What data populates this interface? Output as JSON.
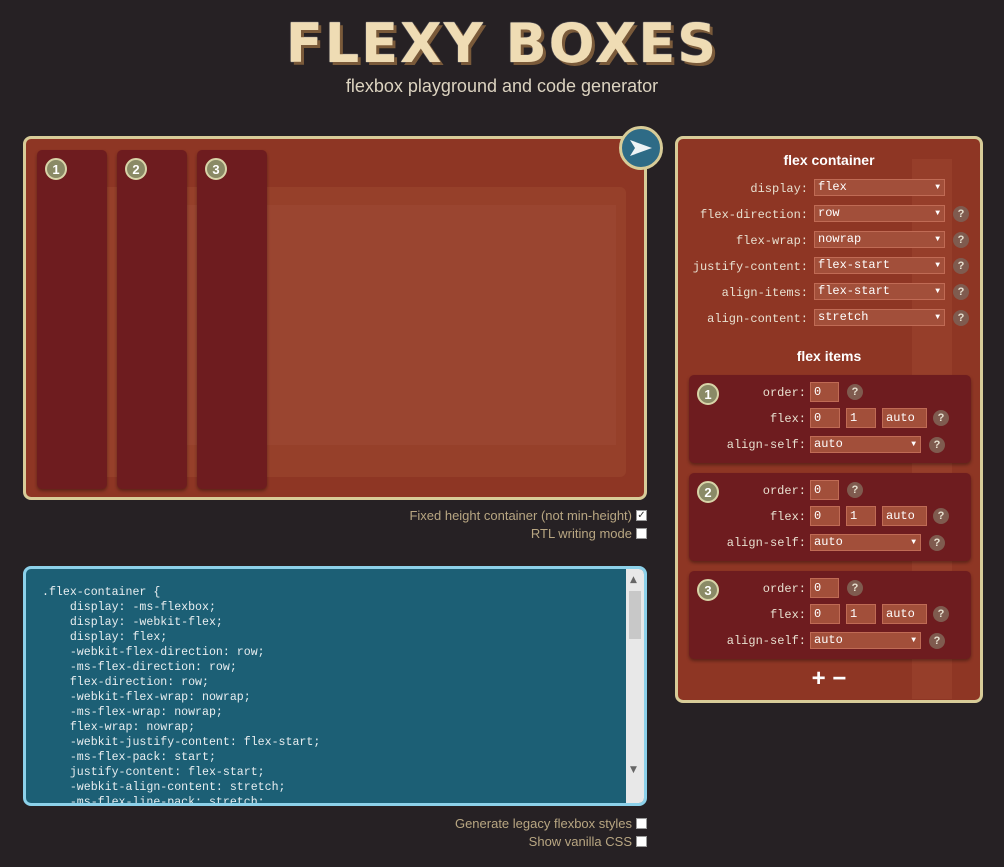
{
  "header": {
    "logo": "FLEXY BOXES",
    "tagline": "flexbox playground and code generator"
  },
  "playground": {
    "items": [
      "1",
      "2",
      "3"
    ]
  },
  "options": {
    "fixed_height": "Fixed height container (not min-height)",
    "fixed_height_checked": true,
    "rtl": "RTL writing mode",
    "legacy": "Generate legacy flexbox styles",
    "vanilla": "Show vanilla CSS"
  },
  "code": {
    "text": ".flex-container {\n    display: -ms-flexbox;\n    display: -webkit-flex;\n    display: flex;\n    -webkit-flex-direction: row;\n    -ms-flex-direction: row;\n    flex-direction: row;\n    -webkit-flex-wrap: nowrap;\n    -ms-flex-wrap: nowrap;\n    flex-wrap: nowrap;\n    -webkit-justify-content: flex-start;\n    -ms-flex-pack: start;\n    justify-content: flex-start;\n    -webkit-align-content: stretch;\n    -ms-flex-line-pack: stretch;"
  },
  "panel": {
    "container_title": "flex container",
    "container_props": [
      {
        "label": "display:",
        "value": "flex"
      },
      {
        "label": "flex-direction:",
        "value": "row"
      },
      {
        "label": "flex-wrap:",
        "value": "nowrap"
      },
      {
        "label": "justify-content:",
        "value": "flex-start"
      },
      {
        "label": "align-items:",
        "value": "flex-start"
      },
      {
        "label": "align-content:",
        "value": "stretch"
      }
    ],
    "help": "?",
    "items_title": "flex items",
    "items": [
      {
        "num": "1",
        "order_label": "order:",
        "order": "0",
        "flex_label": "flex:",
        "grow": "0",
        "shrink": "1",
        "basis": "auto",
        "align_label": "align-self:",
        "align": "auto"
      },
      {
        "num": "2",
        "order_label": "order:",
        "order": "0",
        "flex_label": "flex:",
        "grow": "0",
        "shrink": "1",
        "basis": "auto",
        "align_label": "align-self:",
        "align": "auto"
      },
      {
        "num": "3",
        "order_label": "order:",
        "order": "0",
        "flex_label": "flex:",
        "grow": "0",
        "shrink": "1",
        "basis": "auto",
        "align_label": "align-self:",
        "align": "auto"
      }
    ],
    "add_label": "+",
    "remove_label": "−"
  },
  "colors": {
    "background": "#262124",
    "panel": "#8e3624",
    "item": "#6e1c1f",
    "border": "#d8cc98",
    "code_bg": "#1c5f75",
    "code_border": "#8cd1ea"
  }
}
